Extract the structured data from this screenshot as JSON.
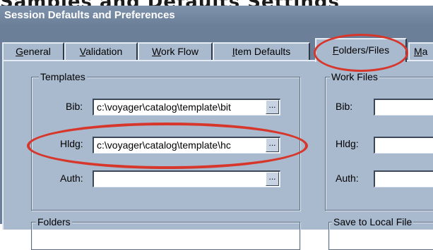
{
  "page_heading": "Samples and Defaults Settings",
  "window": {
    "title": "Session Defaults and Preferences"
  },
  "tabs": [
    {
      "label_u": "G",
      "label_rest": "eneral"
    },
    {
      "label_u": "V",
      "label_rest": "alidation"
    },
    {
      "label_u": "W",
      "label_rest": "ork Flow"
    },
    {
      "label_u": "I",
      "label_rest": "tem Defaults"
    },
    {
      "label_u": "F",
      "label_rest": "olders/Files"
    },
    {
      "label_u": "M",
      "label_rest": "a"
    }
  ],
  "templates": {
    "legend": "Templates",
    "bib": {
      "label": "Bib:",
      "value": "c:\\voyager\\catalog\\template\\bit"
    },
    "hldg": {
      "label": "Hldg:",
      "value": "c:\\voyager\\catalog\\template\\hc"
    },
    "auth": {
      "label": "Auth:",
      "value": ""
    },
    "browse_label": "..."
  },
  "work_files": {
    "legend": "Work Files",
    "bib": {
      "label": "Bib:",
      "value": ""
    },
    "hldg": {
      "label": "Hldg:",
      "value": ""
    },
    "auth": {
      "label": "Auth:",
      "value": ""
    }
  },
  "folders": {
    "legend": "Folders"
  },
  "save_local": {
    "legend": "Save to Local File"
  },
  "annotations": {
    "highlight_color": "#d7362b"
  }
}
